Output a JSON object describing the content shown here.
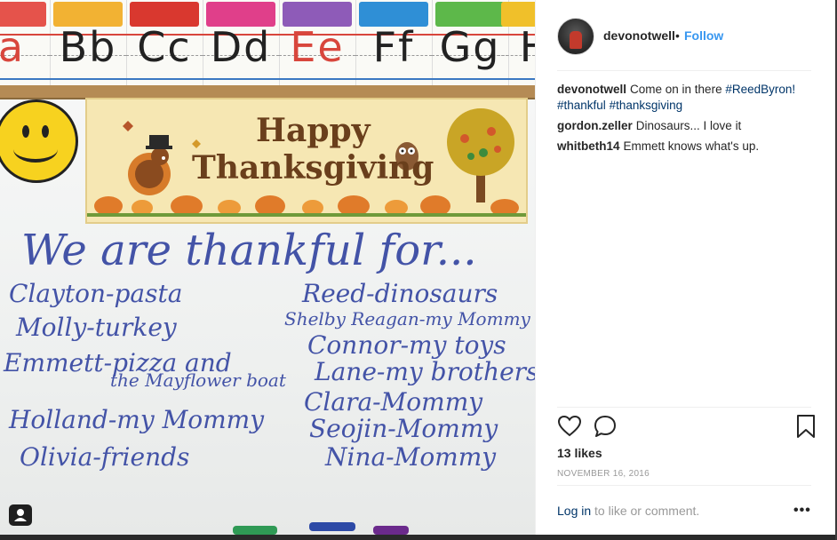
{
  "post": {
    "username": "devonotwell",
    "follow_label": "Follow",
    "separator_dot": "•",
    "caption": {
      "user": "devonotwell",
      "text": "Come on in there",
      "tags": [
        "#ReedByron!",
        "#thankful",
        "#thanksgiving"
      ]
    },
    "comments": [
      {
        "user": "gordon.zeller",
        "text": "Dinosaurs... I love it"
      },
      {
        "user": "whitbeth14",
        "text": "Emmett knows what's up."
      }
    ],
    "likes": "13 likes",
    "date": "NOVEMBER 16, 2016",
    "login_link": "Log in",
    "login_rest": "to like or comment.",
    "more_label": "•••"
  },
  "photo": {
    "alphabet": [
      "a",
      "Bb",
      "Cc",
      "Dd",
      "Ee",
      "Ff",
      "Gg",
      "H"
    ],
    "banner_line1": "Happy",
    "banner_line2": "Thanksgiving",
    "board_title": "We are thankful for...",
    "left_column": [
      "Clayton-pasta",
      "Molly-turkey",
      "Emmett-pizza and",
      "the Mayflower boat",
      "Holland-my Mommy",
      "Olivia-friends"
    ],
    "right_column": [
      "Reed-dinosaurs",
      "Shelby Reagan-my Mommy",
      "Connor-my toys",
      "Lane-my brothers",
      "Clara-Mommy",
      "Seojin-Mommy",
      "Nina-Mommy"
    ]
  },
  "icons": {
    "like": "heart-icon",
    "comment": "comment-bubble-icon",
    "save": "bookmark-icon",
    "photo_badge": "user-tag-icon"
  },
  "colors": {
    "link_blue": "#3897f0",
    "tag_blue": "#003569",
    "marker_ink": "#4353a7",
    "text": "#262626",
    "muted": "#999999"
  }
}
